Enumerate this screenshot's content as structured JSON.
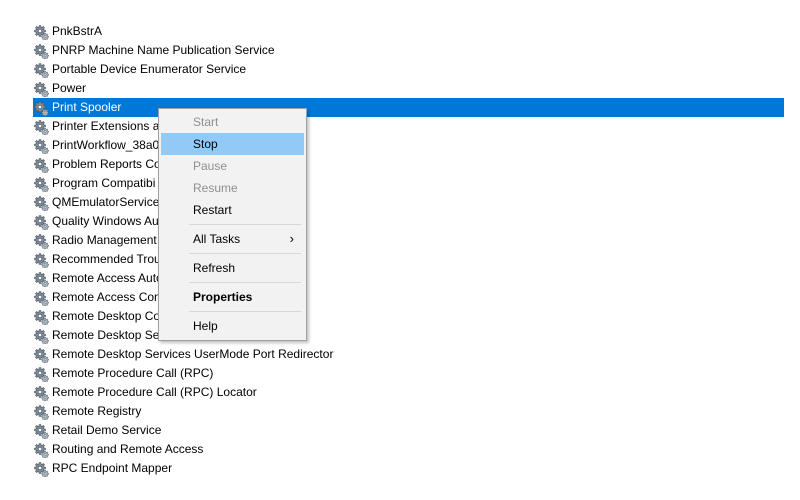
{
  "services": [
    {
      "name": "PnkBstrA"
    },
    {
      "name": "PNRP Machine Name Publication Service"
    },
    {
      "name": "Portable Device Enumerator Service"
    },
    {
      "name": "Power"
    },
    {
      "name": "Print Spooler",
      "selected": true
    },
    {
      "name": "Printer Extensions ar"
    },
    {
      "name": "PrintWorkflow_38a0"
    },
    {
      "name": "Problem Reports Co"
    },
    {
      "name": "Program Compatibi"
    },
    {
      "name": "QMEmulatorService"
    },
    {
      "name": "Quality Windows Au"
    },
    {
      "name": "Radio Management"
    },
    {
      "name": "Recommended Trou"
    },
    {
      "name": "Remote Access Auto"
    },
    {
      "name": "Remote Access Con"
    },
    {
      "name": "Remote Desktop Co"
    },
    {
      "name": "Remote Desktop Se"
    },
    {
      "name": "Remote Desktop Services UserMode Port Redirector"
    },
    {
      "name": "Remote Procedure Call (RPC)"
    },
    {
      "name": "Remote Procedure Call (RPC) Locator"
    },
    {
      "name": "Remote Registry"
    },
    {
      "name": "Retail Demo Service"
    },
    {
      "name": "Routing and Remote Access"
    },
    {
      "name": "RPC Endpoint Mapper"
    }
  ],
  "context_menu": {
    "start": "Start",
    "stop": "Stop",
    "pause": "Pause",
    "resume": "Resume",
    "restart": "Restart",
    "all_tasks": "All Tasks",
    "all_tasks_arrow": "›",
    "refresh": "Refresh",
    "properties": "Properties",
    "help": "Help"
  },
  "colors": {
    "selection": "#0078d7",
    "menu_hover": "#91c9f7",
    "menu_background": "#f2f2f2",
    "disabled_text": "#8f8f8f"
  },
  "icons": {
    "service": "service-gear-icon",
    "submenu": "chevron-right-icon"
  }
}
